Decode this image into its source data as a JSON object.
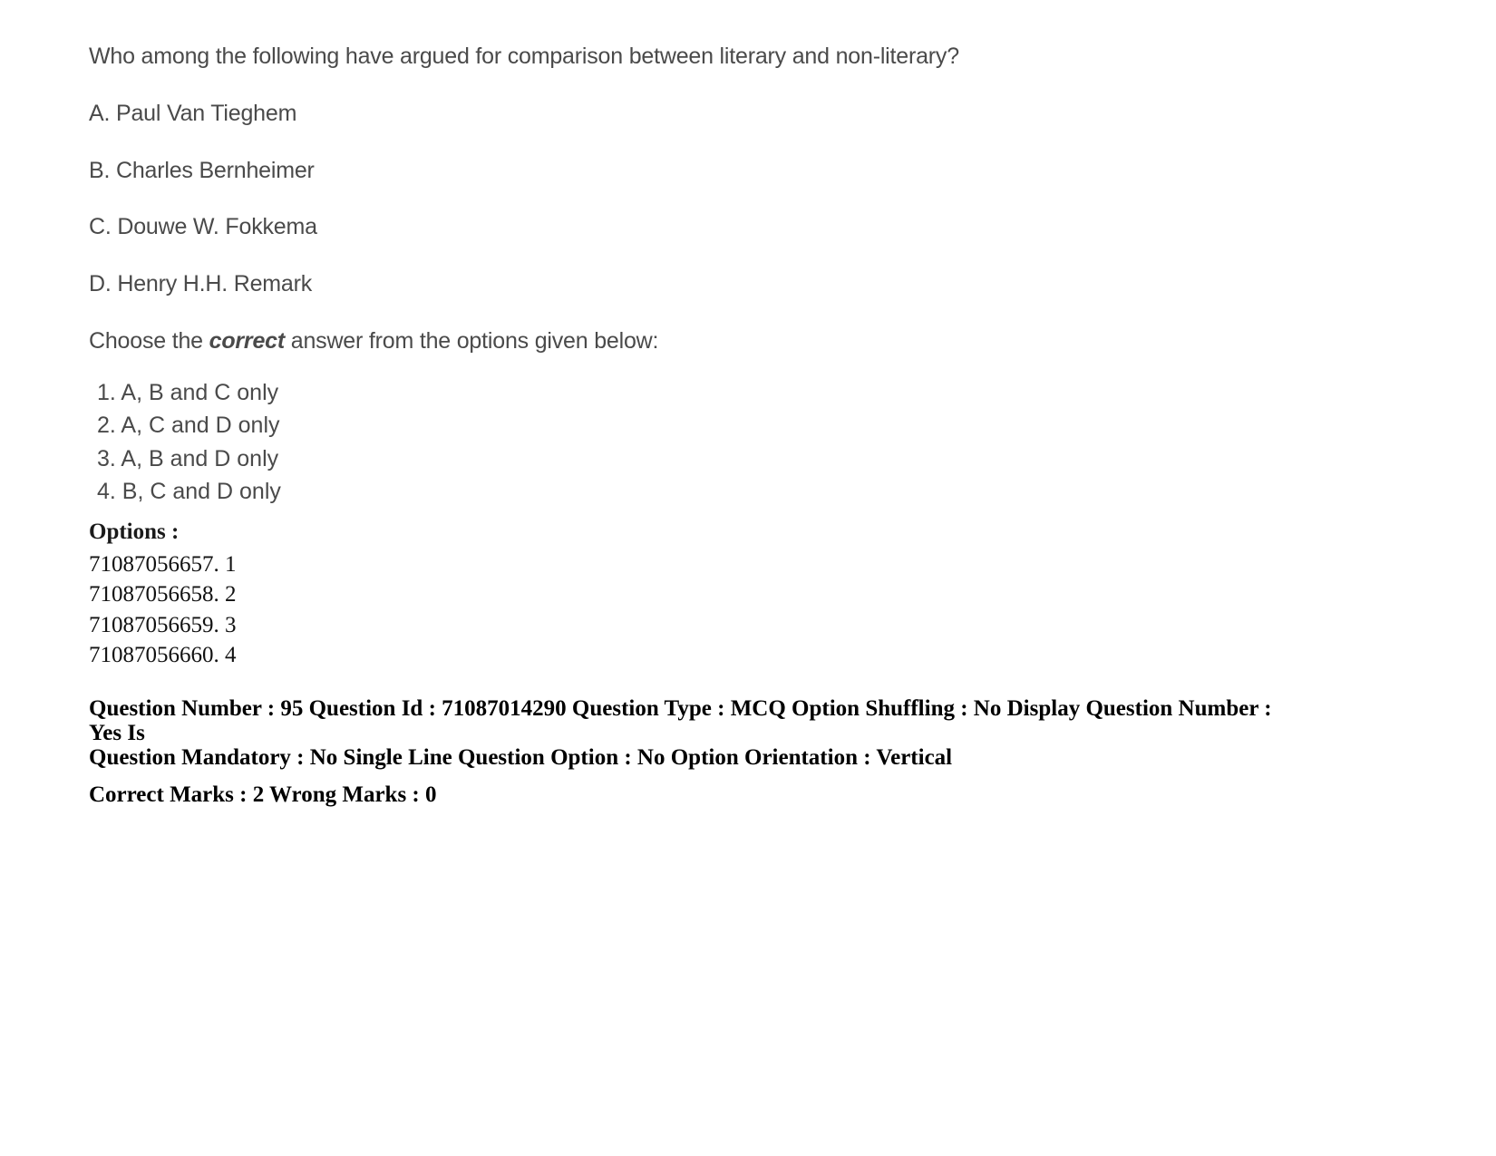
{
  "question": {
    "stem": "Who among the following have argued for comparison between literary and non-literary?",
    "statements": [
      "A. Paul Van Tieghem",
      "B. Charles Bernheimer",
      "C. Douwe W. Fokkema",
      "D. Henry H.H. Remark"
    ],
    "choose_prefix": "Choose the ",
    "choose_emphasis": "correct",
    "choose_suffix": " answer from the options given below:",
    "answers": [
      "1. A, B and C only",
      "2. A, C and D only",
      "3. A, B and D only",
      "4. B, C and D only"
    ]
  },
  "options": {
    "title": "Options :",
    "entries": [
      "71087056657. 1",
      "71087056658. 2",
      "71087056659. 3",
      "71087056660. 4"
    ]
  },
  "metadata": {
    "line1": "Question Number : 95 Question Id : 71087014290 Question Type : MCQ Option Shuffling : No Display Question Number : Yes Is",
    "line2": "Question Mandatory : No Single Line Question Option : No Option Orientation : Vertical",
    "line3": "Correct Marks : 2 Wrong Marks : 0"
  }
}
